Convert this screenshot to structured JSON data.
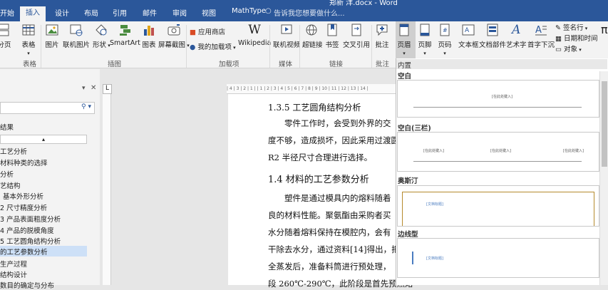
{
  "titlebar": {
    "doc_title": "郑新 洋.docx - Word",
    "tabs": [
      "开始",
      "插入",
      "设计",
      "布局",
      "引用",
      "邮件",
      "审阅",
      "视图",
      "MathType"
    ],
    "tell_me": "告诉我您想要做什么..."
  },
  "ribbon": {
    "buttons": [
      "分页",
      "表格",
      "图片",
      "联机图片",
      "形状",
      "SmartArt",
      "图表",
      "屏幕截图",
      "应用商店",
      "我的加载项",
      "Wikipedia",
      "联机视频",
      "超链接",
      "书签",
      "交叉引用",
      "批注",
      "页眉",
      "页脚",
      "页码",
      "文本框",
      "文档部件",
      "艺术字",
      "首字下沉",
      "签名行",
      "日期和时间",
      "对象"
    ],
    "groups": [
      "表格",
      "插图",
      "加载项",
      "媒体",
      "链接",
      "批注"
    ]
  },
  "nav": {
    "section_label": "结果",
    "items": [
      "工艺分析",
      "材料种类的选择",
      "分析",
      "艺结构",
      "基本外形分析",
      "尺寸精度分析",
      "产品表面粗度分析",
      "产品的脱模角度",
      "工艺圆角结构分析",
      "的工艺参数分析",
      "生产过程",
      "结构设计",
      "数目的确定与分布"
    ]
  },
  "ruler": {
    "text": "| 4 | 3 | 2 | 1 |   | 1 | 2 | 3 | 4 | 5 | 6 | 7 | 8 | 9 | 10 | 11 | 12 | 13 | 14 |"
  },
  "document": {
    "heading1": "1.3.5 工艺圆角结构分析",
    "p1_line1": "零件工作时，会受到外界的交",
    "p1_line2": "度不够，造成损坏，因此采用过渡圆",
    "p1_line3": "R2 半径尺寸合理进行选择。",
    "heading2": "1.4 材料的工艺参数分析",
    "p2_line1": "塑件是通过模具内的熔料随着",
    "p2_line2": "良的材料性能。聚氨酯由采购者买",
    "p2_line3": "水分随着熔料保持在模腔内，会有",
    "p2_line4": "干除去水分，通过资料[14]得出，把原",
    "p2_line5": "全蒸发后，准备料筒进行预处理，",
    "p2_line6": "段 260℃-290℃，此阶段是首先预热熔"
  },
  "gallery": {
    "header": "内置",
    "items": [
      {
        "name": "空白",
        "placeholder": "[在此处键入]"
      },
      {
        "name": "空白(三栏)",
        "placeholder": "[在此处键入]"
      },
      {
        "name": "奥斯汀",
        "placeholder": "[文档标题]"
      },
      {
        "name": "边线型",
        "placeholder": "[文档标题]"
      }
    ]
  },
  "colors": {
    "brand": "#2b579a",
    "ribbon": "#f3f3f3",
    "selected_nav": "#cde0f7"
  }
}
